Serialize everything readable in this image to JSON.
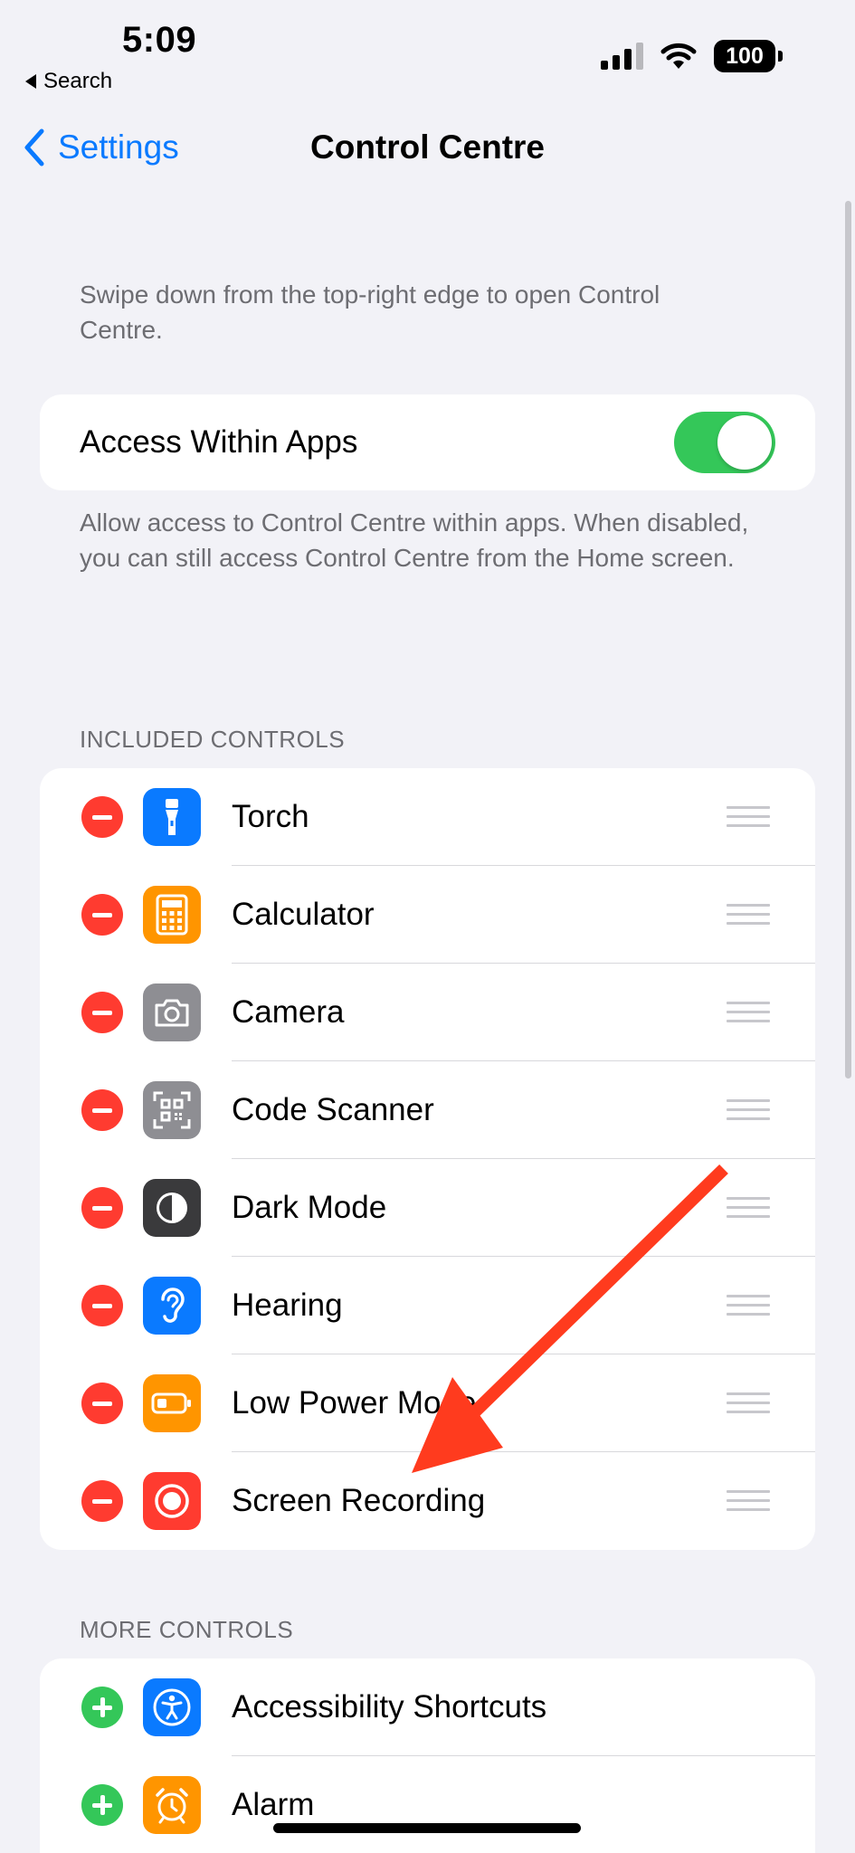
{
  "status_bar": {
    "time": "5:09",
    "back_app": "Search",
    "battery": "100"
  },
  "nav": {
    "back_label": "Settings",
    "title": "Control Centre"
  },
  "intro_note": "Swipe down from the top-right edge to open Control Centre.",
  "access_within_apps": {
    "label": "Access Within Apps",
    "enabled": true
  },
  "access_note": "Allow access to Control Centre within apps. When disabled, you can still access Control Centre from the Home screen.",
  "included": {
    "header": "INCLUDED CONTROLS",
    "items": [
      {
        "label": "Torch",
        "icon": "torch-icon",
        "color": "#0a7aff"
      },
      {
        "label": "Calculator",
        "icon": "calculator-icon",
        "color": "#ff9500"
      },
      {
        "label": "Camera",
        "icon": "camera-icon",
        "color": "#8e8e93"
      },
      {
        "label": "Code Scanner",
        "icon": "qr-code-icon",
        "color": "#8e8e93"
      },
      {
        "label": "Dark Mode",
        "icon": "dark-mode-icon",
        "color": "#3a3a3c"
      },
      {
        "label": "Hearing",
        "icon": "ear-icon",
        "color": "#0a7aff"
      },
      {
        "label": "Low Power Mode",
        "icon": "battery-icon",
        "color": "#ff9500"
      },
      {
        "label": "Screen Recording",
        "icon": "record-icon",
        "color": "#ff3b30"
      }
    ]
  },
  "more": {
    "header": "MORE CONTROLS",
    "items": [
      {
        "label": "Accessibility Shortcuts",
        "icon": "accessibility-icon",
        "color": "#0a7aff"
      },
      {
        "label": "Alarm",
        "icon": "alarm-clock-icon",
        "color": "#ff9500"
      }
    ]
  },
  "colors": {
    "accent": "#0a7aff",
    "toggle_on": "#34c759",
    "remove": "#ff3b30",
    "add": "#34c759",
    "annotation_arrow": "#ff3b1e"
  }
}
